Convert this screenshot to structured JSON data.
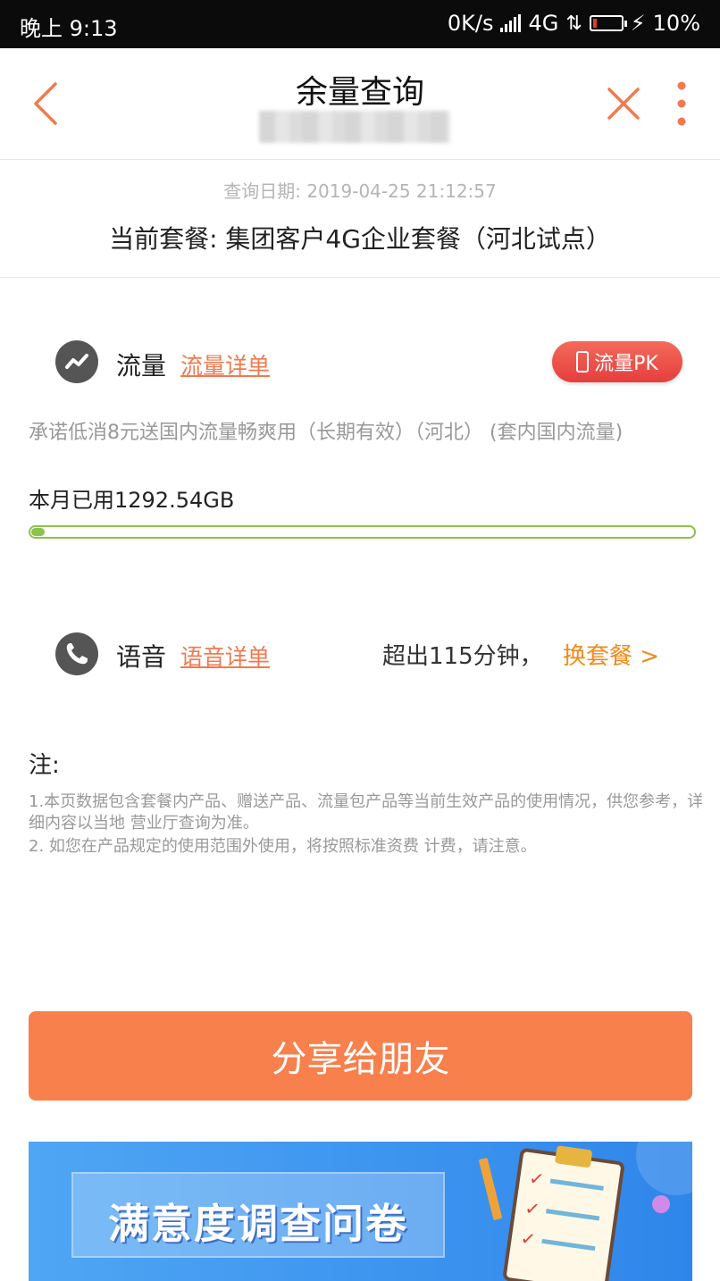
{
  "status_bar": {
    "time": "晚上 9:13",
    "speed": "0K/s",
    "network": "4G",
    "battery": "10%"
  },
  "header": {
    "title": "余量查询"
  },
  "query": {
    "date_label": "查询日期: 2019-04-25 21:12:57",
    "plan_label": "当前套餐:  集团客户4G企业套餐（河北试点）"
  },
  "data_usage": {
    "label": "流量",
    "detail_link": "流量详单",
    "pk_button": "流量PK",
    "description": "承诺低消8元送国内流量畅爽用（长期有效）（河北） (套内国内流量)",
    "used_text": "本月已用1292.54GB",
    "progress_fraction": 0.02,
    "bar_color": "#8bc34a"
  },
  "voice": {
    "label": "语音",
    "detail_link": "语音详单",
    "exceed_text": "超出115分钟，",
    "change_plan": "换套餐 >"
  },
  "notes": {
    "title": "注:",
    "line1": "1.本页数据包含套餐内产品、赠送产品、流量包产品等当前生效产品的使用情况，供您参考，详细内容以当地 营业厅查询为准。",
    "line2": "2. 如您在产品规定的使用范围外使用，将按照标准资费 计费，请注意。"
  },
  "share_button": "分享给朋友",
  "banner": {
    "text": "满意度调查问卷"
  },
  "colors": {
    "accent": "#f7804d",
    "link": "#ef7a4f",
    "orange_text": "#f08a1c"
  }
}
